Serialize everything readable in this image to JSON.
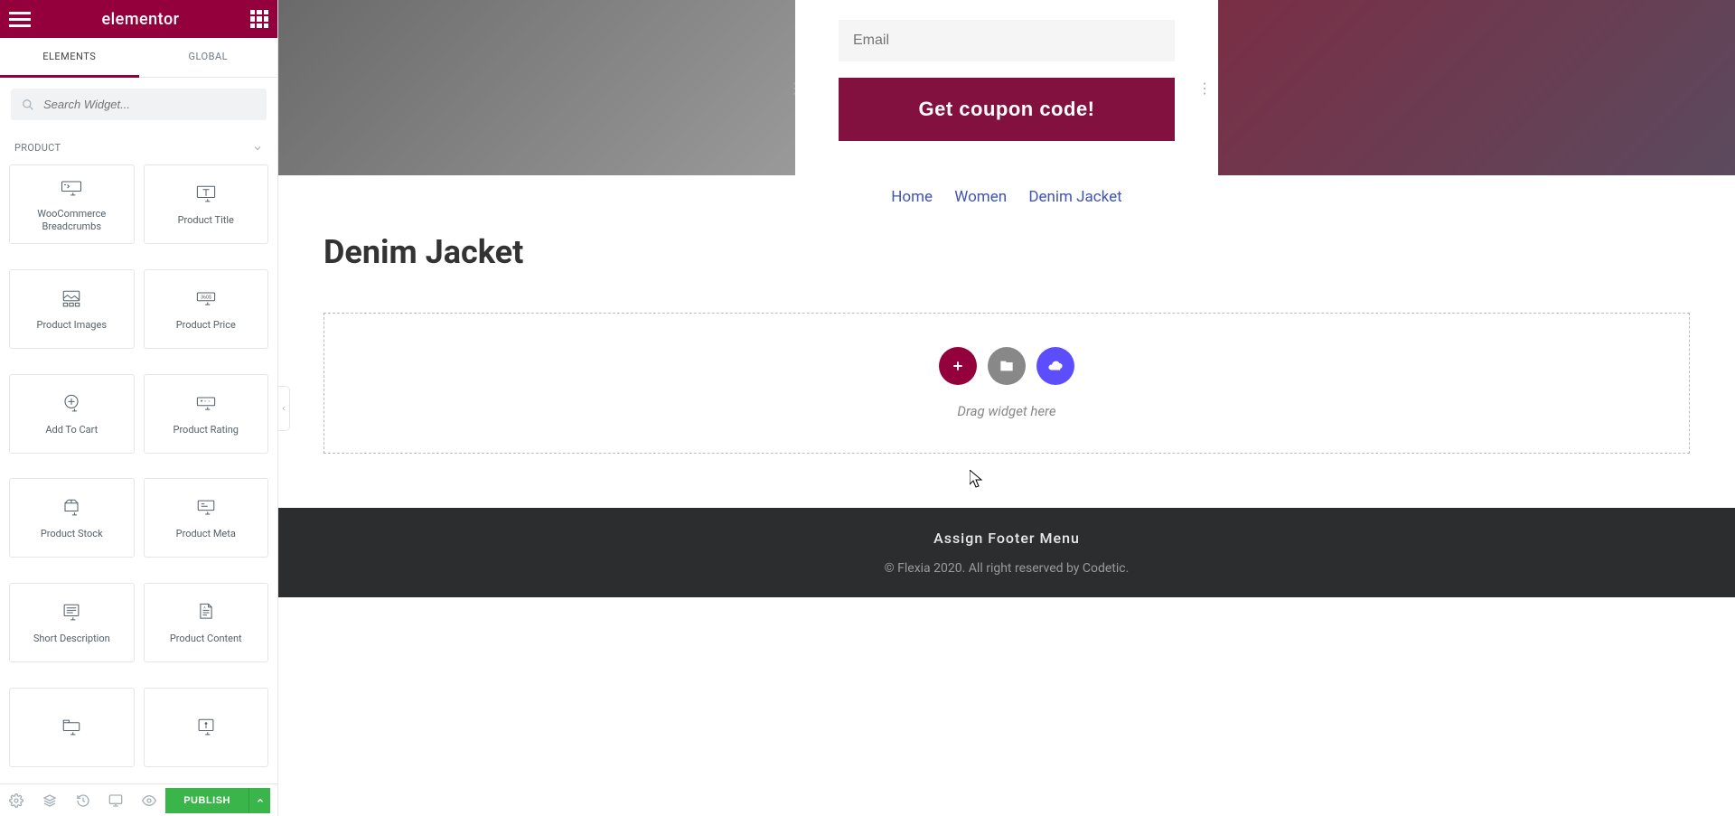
{
  "brand": "elementor",
  "tabs": {
    "elements": "ELEMENTS",
    "global": "GLOBAL"
  },
  "search": {
    "placeholder": "Search Widget..."
  },
  "category": "PRODUCT",
  "widgets": [
    {
      "label": "WooCommerce Breadcrumbs"
    },
    {
      "label": "Product Title"
    },
    {
      "label": "Product Images"
    },
    {
      "label": "Product Price"
    },
    {
      "label": "Add To Cart"
    },
    {
      "label": "Product Rating"
    },
    {
      "label": "Product Stock"
    },
    {
      "label": "Product Meta"
    },
    {
      "label": "Short Description"
    },
    {
      "label": "Product Content"
    }
  ],
  "publish": "PUBLISH",
  "hero": {
    "email_placeholder": "Email",
    "coupon_button": "Get coupon code!"
  },
  "breadcrumb": {
    "home": "Home",
    "women": "Women",
    "current": "Denim Jacket"
  },
  "product": {
    "title": "Denim Jacket"
  },
  "drop": {
    "hint": "Drag widget here"
  },
  "footer": {
    "menu": "Assign Footer Menu",
    "copyright": "© Flexia 2020. All right reserved by Codetic."
  }
}
